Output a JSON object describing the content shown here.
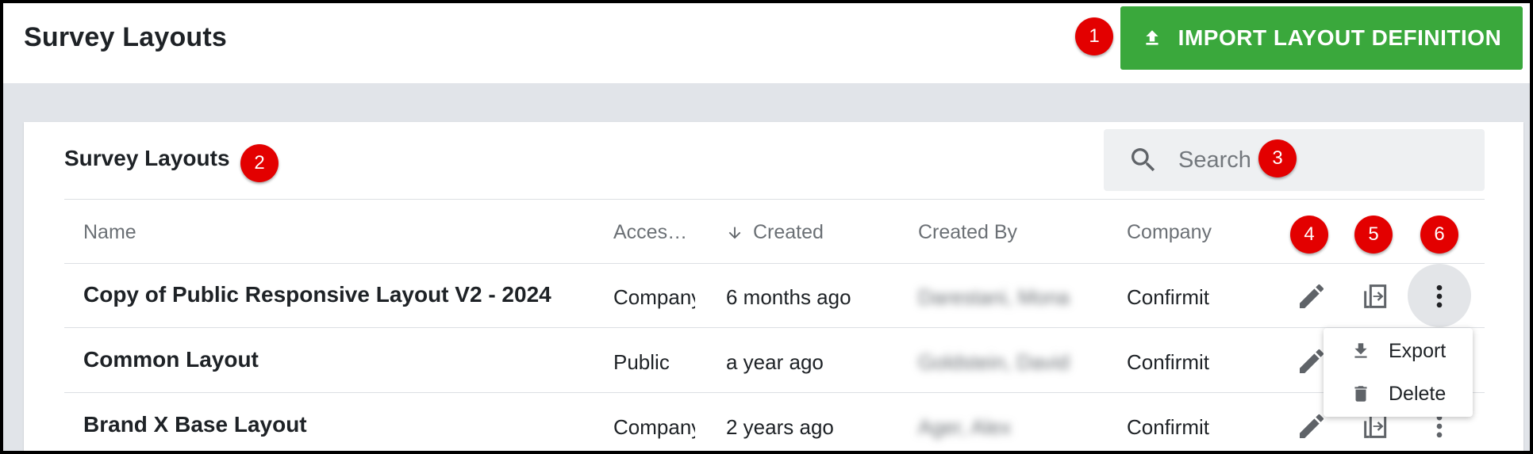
{
  "header": {
    "title": "Survey Layouts",
    "import_button_label": "IMPORT LAYOUT DEFINITION"
  },
  "card": {
    "title": "Survey Layouts",
    "search_placeholder": "Search"
  },
  "table": {
    "columns": {
      "name": "Name",
      "access": "Acces…",
      "created": "Created",
      "created_by": "Created By",
      "company": "Company"
    },
    "sort": {
      "column": "created",
      "direction": "descending"
    },
    "rows": [
      {
        "name": "Copy of Public Responsive Layout V2 - 2024",
        "access": "Company",
        "created": "6 months ago",
        "created_by": "Darestani, Mona",
        "company": "Confirmit"
      },
      {
        "name": "Common Layout",
        "access": "Public",
        "created": "a year ago",
        "created_by": "Goldstein, David",
        "company": "Confirmit"
      },
      {
        "name": "Brand X Base Layout",
        "access": "Company",
        "created": "2 years ago",
        "created_by": "Ager, Alex",
        "company": "Confirmit"
      }
    ]
  },
  "row_menu": {
    "items": [
      {
        "label": "Export",
        "icon": "download-icon"
      },
      {
        "label": "Delete",
        "icon": "trash-icon"
      }
    ]
  },
  "markers": [
    "1",
    "2",
    "3",
    "4",
    "5",
    "6"
  ],
  "colors": {
    "primary_green": "#3aa83c",
    "marker_red": "#e30000",
    "icon_gray": "#5f6368",
    "content_bg": "#e1e4e9"
  }
}
